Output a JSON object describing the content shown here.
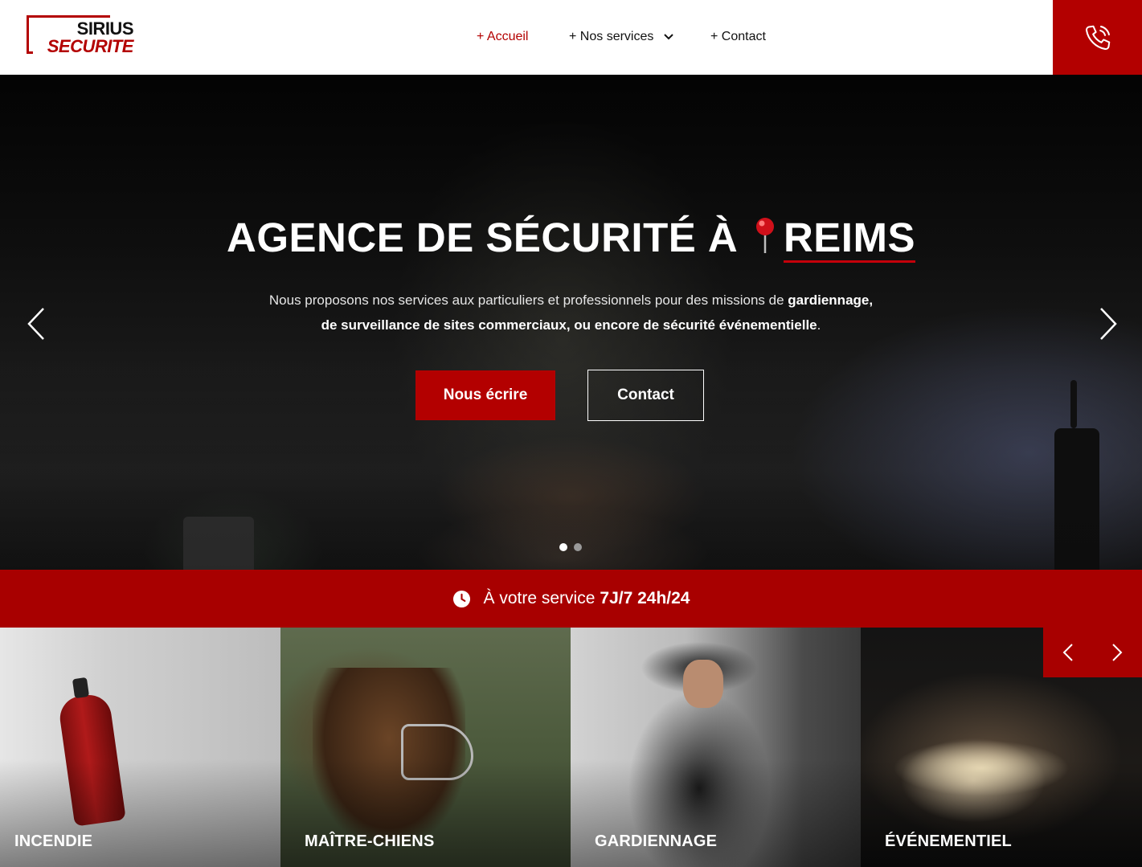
{
  "logo": {
    "line1": "SIRIUS",
    "line2": "SECURITE"
  },
  "nav": {
    "items": [
      {
        "label": "+ Accueil",
        "active": true
      },
      {
        "label": "+ Nos services",
        "has_dropdown": true
      },
      {
        "label": "+ Contact"
      }
    ]
  },
  "phone": {
    "icon": "phone-ringing-icon"
  },
  "hero": {
    "title_prefix": "AGENCE DE SÉCURITÉ À",
    "title_icon": "map-pin-icon",
    "title_city": "REIMS",
    "subtitle_line1_normal": "Nous proposons nos services aux particuliers et professionnels pour des missions de ",
    "subtitle_line1_bold": "gardiennage,",
    "subtitle_line2_bold": "de surveillance de sites commerciaux, ou encore de sécurité événementielle",
    "subtitle_line2_end": ".",
    "button_primary": "Nous écrire",
    "button_secondary": "Contact",
    "slides": 2,
    "active_slide": 1
  },
  "band": {
    "icon": "clock-icon",
    "text": "À votre service",
    "highlight": "7J/7 24h/24"
  },
  "services": [
    {
      "label": "INCENDIE"
    },
    {
      "label": "MAÎTRE-CHIENS"
    },
    {
      "label": "GARDIENNAGE"
    },
    {
      "label": "ÉVÉNEMENTIEL"
    }
  ],
  "colors": {
    "brand_red": "#b30000",
    "band_red": "#a80000"
  }
}
